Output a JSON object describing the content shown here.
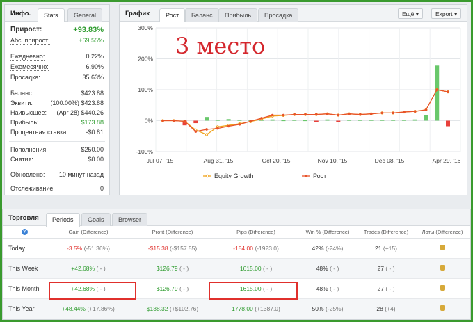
{
  "info": {
    "title": "Инфо.",
    "tabs": [
      "Stats",
      "General"
    ],
    "growth_label": "Прирост:",
    "growth_value": "+93.83%",
    "abs_label": "Абс. прирост:",
    "abs_value": "+69.55%",
    "daily_label": "Ежедневно:",
    "daily_value": "0.22%",
    "monthly_label": "Ежемесячно:",
    "monthly_value": "6.90%",
    "drawdown_label": "Просадка:",
    "drawdown_value": "35.63%",
    "balance_label": "Баланс:",
    "balance_value": "$423.88",
    "equity_label": "Эквити:",
    "equity_value": "(100.00%) $423.88",
    "highest_label": "Наивысшее:",
    "highest_value": "(Apr 28) $440.26",
    "profit_label": "Прибыль:",
    "profit_value": "$173.88",
    "interest_label": "Процентная ставка:",
    "interest_value": "-$0.81",
    "deposits_label": "Пополнения:",
    "deposits_value": "$250.00",
    "withdrawals_label": "Снятия:",
    "withdrawals_value": "$0.00",
    "updated_label": "Обновлено:",
    "updated_value": "10 минут назад",
    "tracking_label": "Отслеживание",
    "tracking_value": "0"
  },
  "chart_panel": {
    "title": "График",
    "tabs": [
      "Рост",
      "Баланс",
      "Прибыль",
      "Просадка"
    ],
    "more_button": "Ещё",
    "export_button": "Export",
    "overlay_text": "3 место"
  },
  "chart_data": {
    "type": "line",
    "y_ticks": [
      "300%",
      "200%",
      "100%",
      "0%",
      "-100%"
    ],
    "ylim": [
      -100,
      300
    ],
    "x_ticks": [
      "Jul 07, '15",
      "Aug 31, '15",
      "Oct 20, '15",
      "Nov 10, '15",
      "Dec 08, '15",
      "Apr 29, '16"
    ],
    "legend": [
      "Equity Growth",
      "Рост"
    ],
    "growth_series": [
      0,
      0,
      -2,
      -35,
      -28,
      -25,
      -18,
      -12,
      -2,
      8,
      18,
      18,
      20,
      20,
      20,
      22,
      18,
      22,
      20,
      22,
      25,
      25,
      28,
      30,
      35,
      100,
      93
    ],
    "equity_series": [
      0,
      0,
      -2,
      -30,
      -45,
      -20,
      -15,
      -10,
      -3,
      5,
      15,
      17,
      20,
      20,
      20,
      22,
      18,
      22,
      20,
      22,
      25,
      25,
      28,
      30,
      35,
      100,
      93
    ],
    "bars": [
      0,
      0,
      -15,
      -8,
      12,
      3,
      5,
      3,
      3,
      3,
      4,
      2,
      3,
      2,
      -5,
      4,
      -4,
      3,
      3,
      3,
      3,
      3,
      3,
      4,
      18,
      178,
      -18
    ]
  },
  "trading": {
    "title": "Торговля",
    "tabs": [
      "Periods",
      "Goals",
      "Browser"
    ],
    "columns": [
      "Gain (Difference)",
      "Profit (Difference)",
      "Pips (Difference)",
      "Win % (Difference)",
      "Trades (Difference)",
      "Лоты (Difference)"
    ],
    "rows": [
      {
        "period": "Today",
        "gain": "-3.5%",
        "gain_diff": "(-51.36%)",
        "profit": "-$15.38",
        "profit_diff": "(-$157.55)",
        "pips": "-154.00",
        "pips_diff": "(-1923.0)",
        "win": "42%",
        "win_diff": "(-24%)",
        "trades": "21",
        "trades_diff": "(+15)",
        "gain_color": "red",
        "profit_color": "red",
        "pips_color": "red"
      },
      {
        "period": "This Week",
        "gain": "+42.68%",
        "gain_diff": "( - )",
        "profit": "$126.79",
        "profit_diff": "( - )",
        "pips": "1615.00",
        "pips_diff": "( - )",
        "win": "48%",
        "win_diff": "( - )",
        "trades": "27",
        "trades_diff": "( - )",
        "gain_color": "green",
        "profit_color": "green",
        "pips_color": "green"
      },
      {
        "period": "This Month",
        "gain": "+42.68%",
        "gain_diff": "( - )",
        "profit": "$126.79",
        "profit_diff": "( - )",
        "pips": "1615.00",
        "pips_diff": "( - )",
        "win": "48%",
        "win_diff": "( - )",
        "trades": "27",
        "trades_diff": "( - )",
        "gain_color": "green",
        "profit_color": "green",
        "pips_color": "green"
      },
      {
        "period": "This Year",
        "gain": "+48.44%",
        "gain_diff": "(+17.86%)",
        "profit": "$138.32",
        "profit_diff": "(+$102.76)",
        "pips": "1778.00",
        "pips_diff": "(+1387.0)",
        "win": "50%",
        "win_diff": "(-25%)",
        "trades": "28",
        "trades_diff": "(+4)",
        "gain_color": "green",
        "profit_color": "green",
        "pips_color": "green"
      }
    ]
  },
  "colors": {
    "growth_line": "#e8532a",
    "equity_line": "#f0a31d",
    "bar_positive": "#69c86b",
    "bar_negative": "#e8403b",
    "highlight": "#e0302c"
  }
}
